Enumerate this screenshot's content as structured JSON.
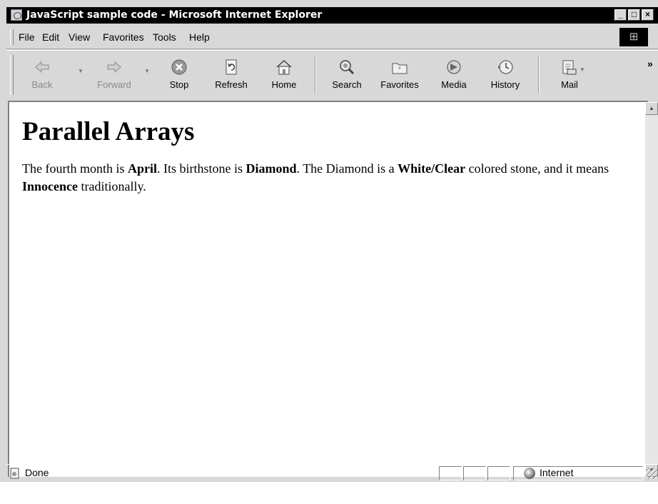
{
  "window": {
    "title": "JavaScript sample code - Microsoft Internet Explorer"
  },
  "menu": [
    "File",
    "Edit",
    "View",
    "Favorites",
    "Tools",
    "Help"
  ],
  "toolbar": {
    "back": "Back",
    "forward": "Forward",
    "stop": "Stop",
    "refresh": "Refresh",
    "home": "Home",
    "search": "Search",
    "favorites": "Favorites",
    "media": "Media",
    "history": "History",
    "mail": "Mail"
  },
  "page": {
    "heading": "Parallel Arrays",
    "text_1": "The fourth month is ",
    "month": "April",
    "text_2": ". Its birthstone is ",
    "stone": "Diamond",
    "text_3": ". The Diamond is a ",
    "color": "White/Clear",
    "text_4": " colored stone, and it means ",
    "meaning": "Innocence",
    "text_5": " traditionally."
  },
  "status": {
    "text": "Done",
    "zone": "Internet"
  }
}
